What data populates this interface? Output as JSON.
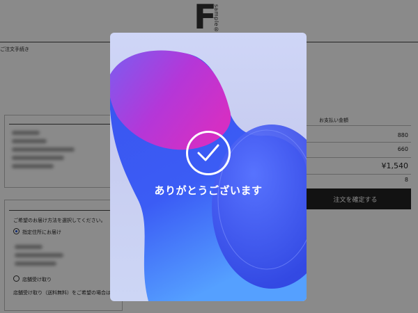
{
  "header": {
    "logo_letter": "F",
    "logo_text": "sample®"
  },
  "breadcrumb": "ご注文手続き",
  "delivery": {
    "prompt": "ご希望のお届け方法を選択してください。",
    "option_home": "指定住所にお届け",
    "option_store": "店舗受け取り",
    "store_note": "店舗受け取り（送料無料）をご希望の場合は"
  },
  "summary": {
    "title": "お支払い金額",
    "subtotal": "880",
    "shipping": "660",
    "total": "¥1,540",
    "points": "8"
  },
  "confirm_button": "注文を確定する",
  "modal": {
    "message": "ありがとうございます"
  },
  "colors": {
    "accent": "#1b4fd6",
    "button": "#222222"
  }
}
